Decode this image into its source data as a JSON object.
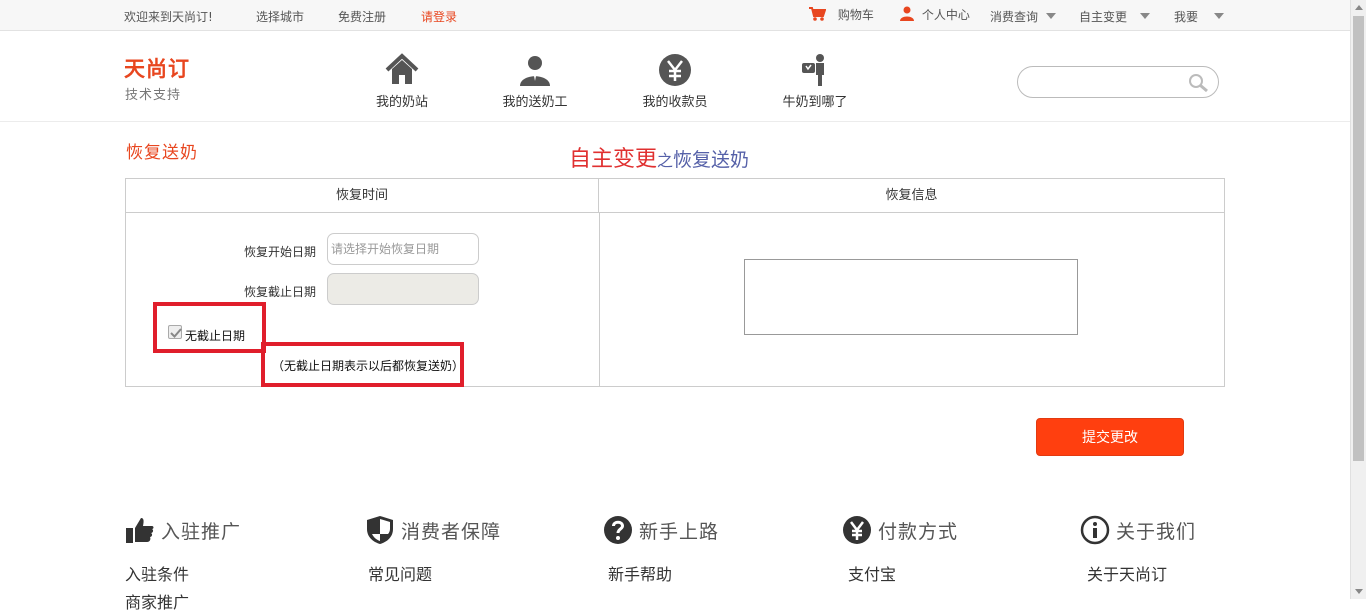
{
  "topbar": {
    "welcome": "欢迎来到天尚订!",
    "select_city": "选择城市",
    "register": "免费注册",
    "login": "请登录",
    "cart": "购物车",
    "personal_center": "个人中心",
    "consume_query": "消费查询",
    "self_change": "自主变更",
    "i_want": "我要",
    "login_color": "#e8461f",
    "icon_color": "#e8461f"
  },
  "header": {
    "logo": "天尚订",
    "logo_sub": "技术支持",
    "nav": [
      {
        "label": "我的奶站",
        "icon": "home-icon"
      },
      {
        "label": "我的送奶工",
        "icon": "user-icon"
      },
      {
        "label": "我的收款员",
        "icon": "yen-icon"
      },
      {
        "label": "牛奶到哪了",
        "icon": "delivery-icon"
      }
    ],
    "search": {
      "placeholder": "",
      "icon": "search-icon"
    }
  },
  "main": {
    "page_label": "恢复送奶",
    "heading_part1": "自主变更",
    "heading_part2": "之",
    "heading_part3": "恢复送奶",
    "table": {
      "col_time": "恢复时间",
      "col_info": "恢复信息",
      "start_label": "恢复开始日期",
      "start_placeholder": "请选择开始恢复日期",
      "start_value": "",
      "end_label": "恢复截止日期",
      "end_value": "",
      "no_end_label": "无截止日期",
      "no_end_checked": true,
      "note": "（无截止日期表示以后都恢复送奶）"
    },
    "submit_label": "提交更改",
    "accent_color": "#ff3f0f",
    "highlight_color": "#e01e2b"
  },
  "footer": {
    "columns": [
      {
        "title": "入驻推广",
        "icon": "thumbs-up-icon",
        "links": [
          "入驻条件",
          "商家推广"
        ]
      },
      {
        "title": "消费者保障",
        "icon": "shield-icon",
        "links": [
          "常见问题"
        ]
      },
      {
        "title": "新手上路",
        "icon": "question-icon",
        "links": [
          "新手帮助"
        ]
      },
      {
        "title": "付款方式",
        "icon": "yen-circle-icon",
        "links": [
          "支付宝"
        ]
      },
      {
        "title": "关于我们",
        "icon": "info-icon",
        "links": [
          "关于天尚订"
        ]
      }
    ]
  }
}
